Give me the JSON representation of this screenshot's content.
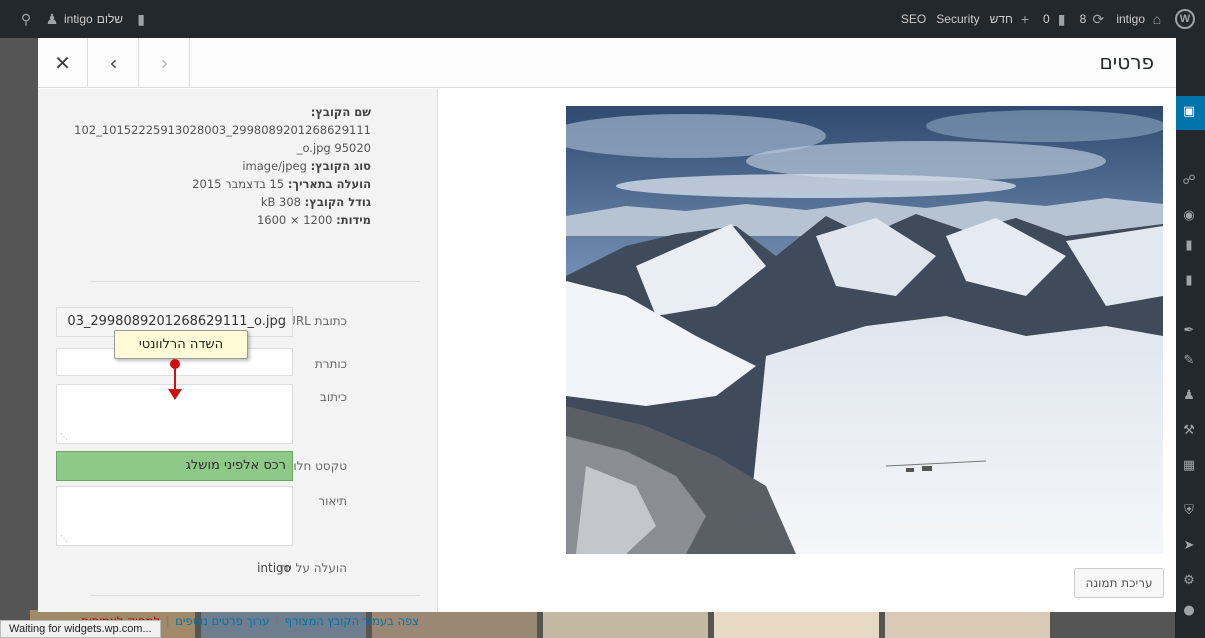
{
  "adminbar": {
    "left": {
      "greeting": "שלום",
      "user": "intigo"
    },
    "right": {
      "seo": "SEO",
      "security": "Security",
      "new_label": "חדש",
      "comments_count": "0",
      "updates_count": "8",
      "site_name": "intigo"
    }
  },
  "modal": {
    "title": "פרטים",
    "file_info": {
      "file_name_label": "שם הקובץ:",
      "file_name_value": "2998089201268629111_10152225913028003_10295020 o.jpg_",
      "file_type_label": "סוג הקובץ:",
      "file_type_value": "image/jpeg",
      "uploaded_label": "הועלה בתאריך:",
      "uploaded_value": "15 בדצמבר 2015",
      "file_size_label": "גודל הקובץ:",
      "file_size_value": "kB 308",
      "dimensions_label": "מידות:",
      "dimensions_value": "1200 × 1600"
    },
    "fields": {
      "url_label": "כתובת URL",
      "url_value": "03_2998089201268629111_o.jpg",
      "title_label": "כותרת",
      "title_value": "",
      "caption_label": "כיתוב",
      "caption_value": "",
      "alt_label": "טקסט חלופי",
      "alt_value": "רכס אלפיני מושלג",
      "description_label": "תיאור",
      "description_value": "",
      "uploaded_by_label": "הועלה על ידי",
      "uploaded_by_value": "intigo"
    },
    "tooltip_text": "השדה הרלוונטי",
    "footer": {
      "view_attachment": "צפה בעמוד הקובץ המצורף",
      "edit_more": "ערוך פרטים נוספים",
      "delete": "למחוק לצמיתות",
      "separator": "|"
    },
    "edit_image_button": "עריכת תמונה"
  },
  "statusbar": "Waiting for widgets.wp.com...",
  "colors": {
    "adminbar": "#23282d",
    "accent": "#0073aa",
    "highlight": "#8fc98a",
    "annotation": "#d01010",
    "danger": "#a00000"
  }
}
